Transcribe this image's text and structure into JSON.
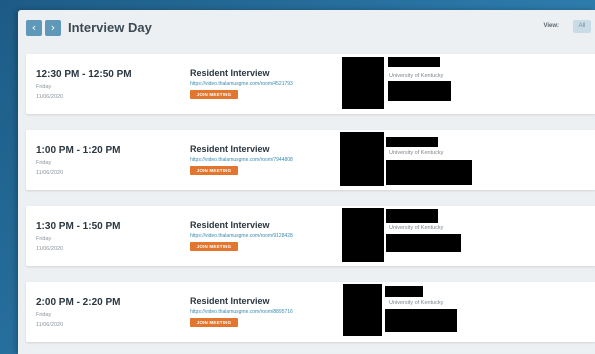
{
  "header": {
    "prev_icon": "‹",
    "next_icon": "›",
    "title": "Interview Day",
    "view_label": "View:",
    "view_all": "All"
  },
  "join_label": "JOIN MEETING",
  "appointments": [
    {
      "time": "12:30 PM - 12:50 PM",
      "day": "Friday",
      "date": "11/06/2020",
      "title": "Resident Interview",
      "link": "https://video.thalamusgme.com/room/4521793",
      "organization": "University of Kentucky"
    },
    {
      "time": "1:00 PM - 1:20 PM",
      "day": "Friday",
      "date": "11/06/2020",
      "title": "Resident Interview",
      "link": "https://video.thalamusgme.com/room/7944808",
      "organization": "University of Kentucky"
    },
    {
      "time": "1:30 PM - 1:50 PM",
      "day": "Friday",
      "date": "11/06/2020",
      "title": "Resident Interview",
      "link": "https://video.thalamusgme.com/room/9128428",
      "organization": "University of Kentucky"
    },
    {
      "time": "2:00 PM - 2:20 PM",
      "day": "Friday",
      "date": "11/06/2020",
      "title": "Resident Interview",
      "link": "https://video.thalamusgme.com/room/8895716",
      "organization": "University of Kentucky"
    }
  ]
}
